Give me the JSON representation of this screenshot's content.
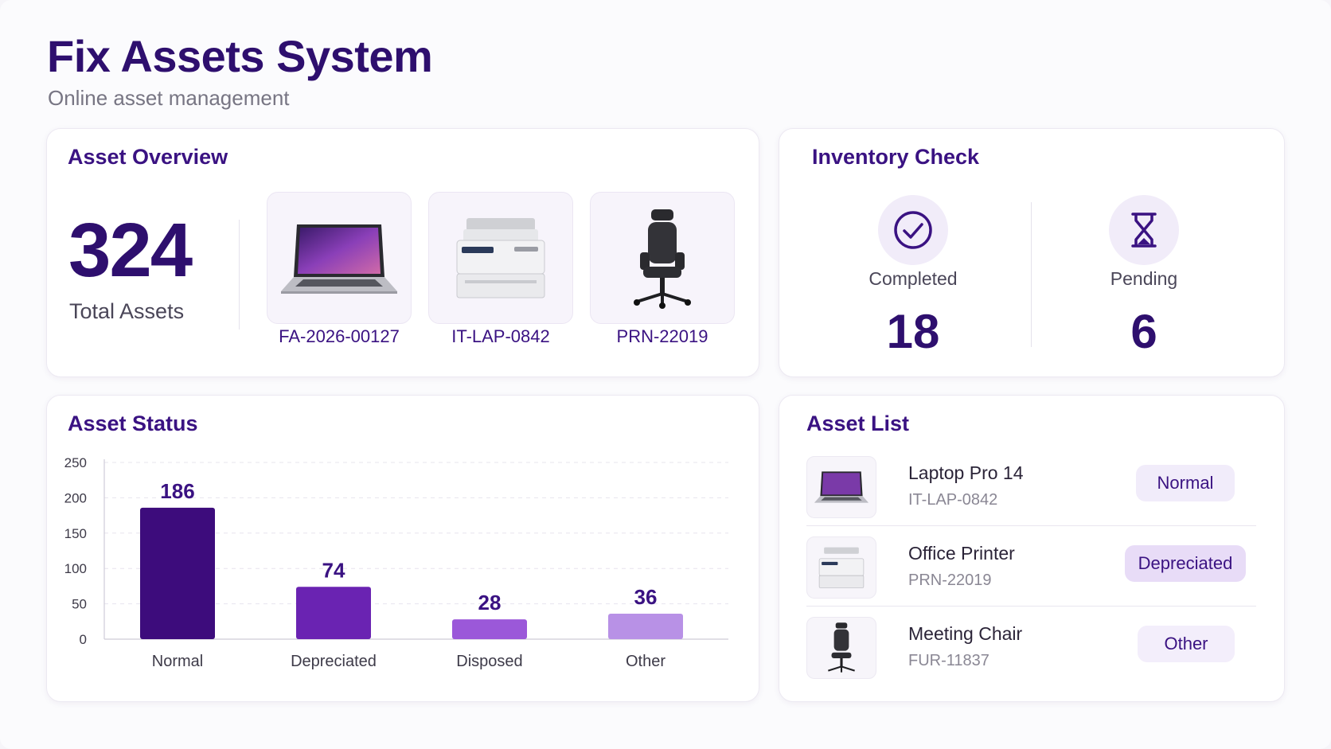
{
  "app": {
    "title": "Fix Assets System",
    "subtitle": "Online asset management"
  },
  "overview": {
    "title": "Asset Overview",
    "total_value": "324",
    "total_label": "Total Assets",
    "items": [
      {
        "code": "FA-2026-00127",
        "icon": "laptop-icon"
      },
      {
        "code": "IT-LAP-0842",
        "icon": "printer-icon"
      },
      {
        "code": "PRN-22019",
        "icon": "office-chair-icon"
      }
    ]
  },
  "inventory": {
    "title": "Inventory Check",
    "completed_label": "Completed",
    "completed_value": "18",
    "pending_label": "Pending",
    "pending_value": "6"
  },
  "status": {
    "title": "Asset Status"
  },
  "chart_data": {
    "type": "bar",
    "categories": [
      "Normal",
      "Depreciated",
      "Disposed",
      "Other"
    ],
    "values": [
      186,
      74,
      28,
      36
    ],
    "ylim": [
      0,
      250
    ],
    "yticks": [
      0,
      50,
      100,
      150,
      200,
      250
    ],
    "grid": true,
    "bar_colors": [
      "#3d0c7c",
      "#6a23b2",
      "#9b58d9",
      "#b891e6"
    ]
  },
  "asset_list": {
    "title": "Asset List",
    "items": [
      {
        "name": "Laptop Pro 14",
        "code": "IT-LAP-0842",
        "status": "Normal",
        "icon": "laptop-icon"
      },
      {
        "name": "Office Printer",
        "code": "PRN-22019",
        "status": "Depreciated",
        "icon": "printer-icon"
      },
      {
        "name": "Meeting Chair",
        "code": "FUR-11837",
        "status": "Other",
        "icon": "office-chair-icon"
      }
    ]
  },
  "colors": {
    "brand": "#2e0f6e",
    "accent": "#3a1282",
    "badge_normal": "#f1ecfa",
    "badge_depreciated": "#e8dcf7",
    "badge_other": "#f3eefb"
  }
}
